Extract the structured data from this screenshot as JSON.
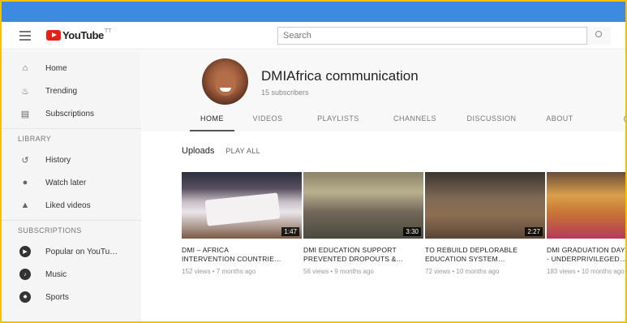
{
  "top": {
    "logo_text": "YouTube",
    "logo_sup": "TT",
    "search_placeholder": "Search"
  },
  "sidebar": {
    "main_items": [
      {
        "label": "Home",
        "icon": "home-icon"
      },
      {
        "label": "Trending",
        "icon": "flame-icon"
      },
      {
        "label": "Subscriptions",
        "icon": "subscriptions-icon"
      }
    ],
    "library_heading": "LIBRARY",
    "library_items": [
      {
        "label": "History",
        "icon": "history-icon"
      },
      {
        "label": "Watch later",
        "icon": "clock-icon"
      },
      {
        "label": "Liked videos",
        "icon": "thumbs-up-icon"
      }
    ],
    "subscriptions_heading": "SUBSCRIPTIONS",
    "subscription_items": [
      {
        "label": "Popular on YouTu…",
        "icon": "popular-icon"
      },
      {
        "label": "Music",
        "icon": "music-icon"
      },
      {
        "label": "Sports",
        "icon": "sports-icon"
      }
    ]
  },
  "channel": {
    "name": "DMIAfrica communication",
    "subscribers": "15 subscribers",
    "tabs": [
      "HOME",
      "VIDEOS",
      "PLAYLISTS",
      "CHANNELS",
      "DISCUSSION",
      "ABOUT"
    ]
  },
  "uploads": {
    "title": "Uploads",
    "play_all": "PLAY ALL",
    "videos": [
      {
        "title_line1": "DMI – AFRICA",
        "title_line2": "INTERVENTION COUNTRIE…",
        "meta": "152 views • 7 months ago",
        "duration": "1:47"
      },
      {
        "title_line1": "DMI EDUCATION SUPPORT",
        "title_line2": "PREVENTED DROPOUTS &…",
        "meta": "56 views • 9 months ago",
        "duration": "3:30"
      },
      {
        "title_line1": "TO REBUILD DEPLORABLE",
        "title_line2": "EDUCATION SYSTEM…",
        "meta": "72 views • 10 months ago",
        "duration": "2:27"
      },
      {
        "title_line1": "DMI GRADUATION DAY",
        "title_line2": "- UNDERPRIVILEGED…",
        "meta": "183 views • 10 months ago",
        "duration": ""
      }
    ]
  },
  "colors": {
    "top_strip": "#3d8be0",
    "frame_border": "#f2c200",
    "youtube_red": "#e62117"
  }
}
